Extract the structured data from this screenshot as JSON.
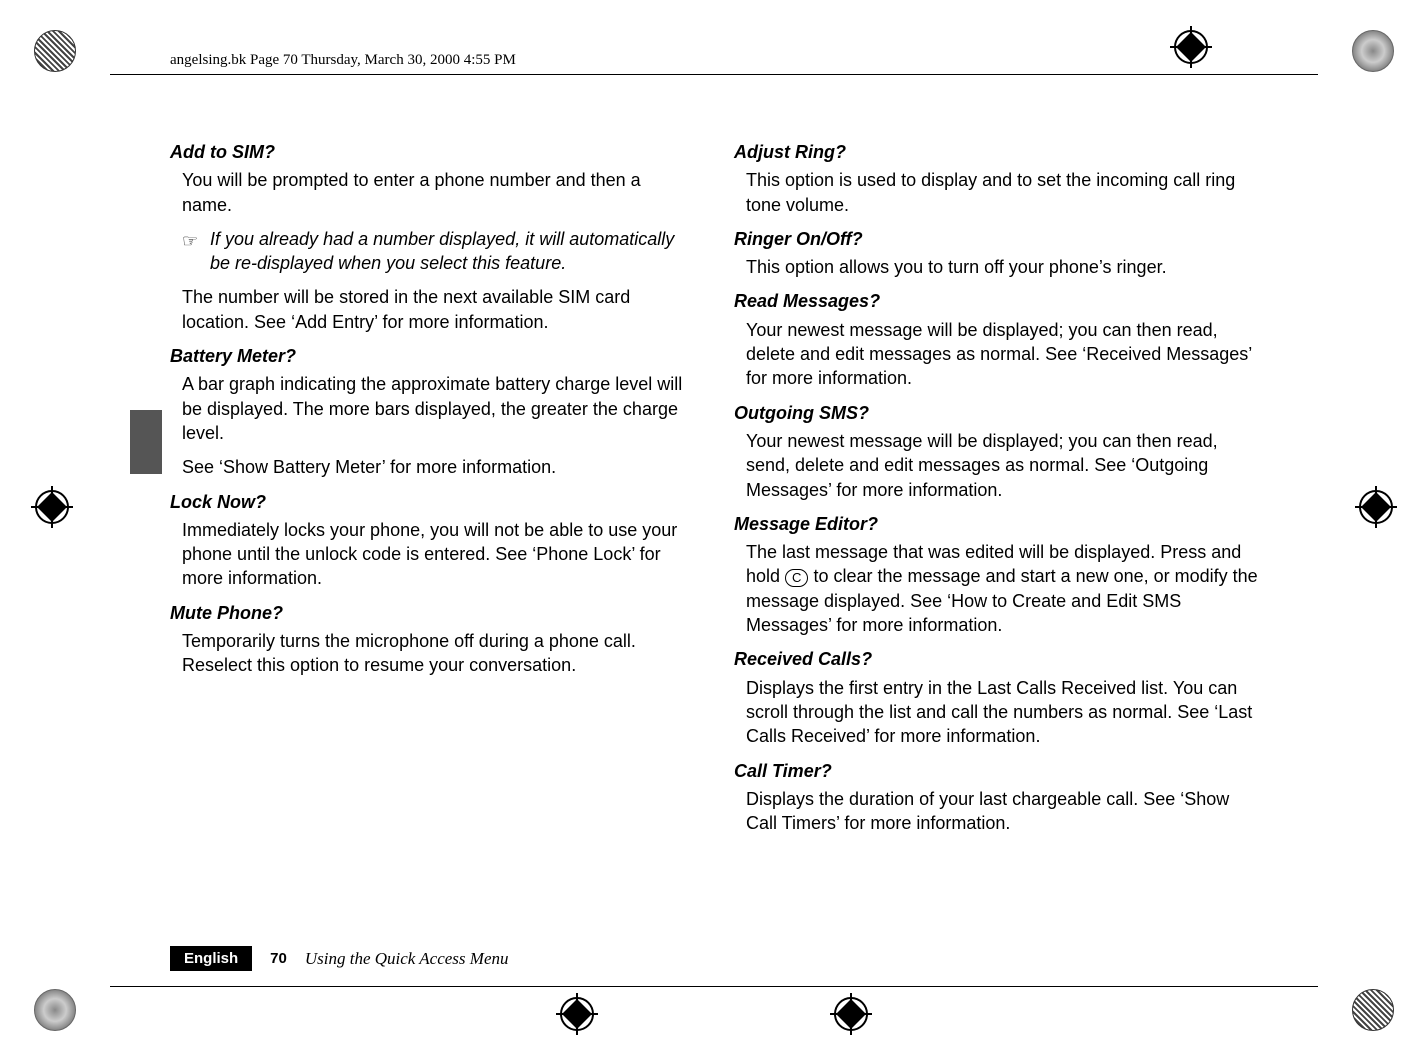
{
  "header": "angelsing.bk  Page 70  Thursday, March 30, 2000  4:55 PM",
  "left": {
    "s1": {
      "title": "Add to SIM?",
      "p1": "You will be prompted to enter a phone number and then a name.",
      "note": "If you already had a number displayed, it will automatically be re-displayed when you select this feature.",
      "p2": "The number will be stored in the next available SIM card location. See ‘Add Entry’ for more information."
    },
    "s2": {
      "title": "Battery Meter?",
      "p1": "A bar graph indicating the approximate battery charge level will be displayed. The more bars displayed, the greater the charge level.",
      "p2": "See ‘Show Battery Meter’ for more information."
    },
    "s3": {
      "title": "Lock Now?",
      "p1": "Immediately locks your phone, you will not be able to use your phone until the unlock code is entered. See ‘Phone Lock’ for more information."
    },
    "s4": {
      "title": "Mute Phone?",
      "p1": "Temporarily turns the microphone off during a phone call. Reselect this option to resume your conversation."
    }
  },
  "right": {
    "s1": {
      "title": "Adjust Ring?",
      "p1": "This option is used to display and to set the incoming call ring tone volume."
    },
    "s2": {
      "title": "Ringer On/Off?",
      "p1": "This option allows you to turn off your phone’s ringer."
    },
    "s3": {
      "title": "Read Messages?",
      "p1": "Your newest message will be displayed; you can then read, delete and edit messages as normal. See ‘Received Messages’ for more information."
    },
    "s4": {
      "title": "Outgoing SMS?",
      "p1": "Your newest message will be displayed; you can then read, send, delete and edit messages as normal. See ‘Outgoing Messages’ for more information."
    },
    "s5": {
      "title": "Message Editor?",
      "p1a": "The last message that was edited will be displayed. Press and hold ",
      "p1b": " to clear the message and start a new one, or modify the message displayed. See ‘How to Create and Edit SMS Messages’ for more information.",
      "btn": "C"
    },
    "s6": {
      "title": "Received Calls?",
      "p1": "Displays the first entry in the Last Calls Received list. You can scroll through the list and call the numbers as normal. See ‘Last Calls Received’ for more information."
    },
    "s7": {
      "title": "Call Timer?",
      "p1": "Displays the duration of your last chargeable call. See ‘Show Call Timers’ for more information."
    }
  },
  "footer": {
    "lang": "English",
    "page": "70",
    "title": "Using the Quick Access Menu"
  }
}
